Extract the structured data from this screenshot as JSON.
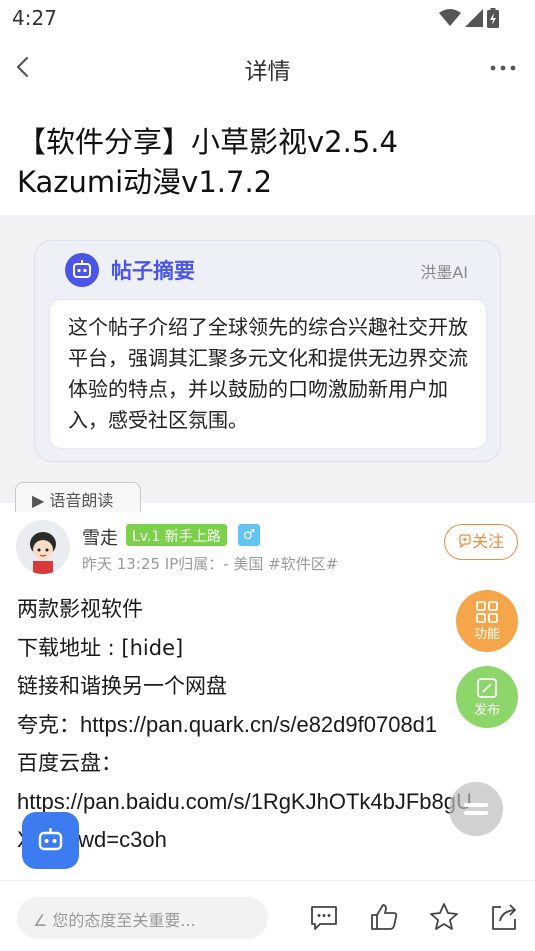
{
  "status_bar": {
    "time": "4:27"
  },
  "nav": {
    "title": "详情"
  },
  "post": {
    "title_line1": "【软件分享】小草影视v2.5.4",
    "title_line2": "Kazumi动漫v1.7.2"
  },
  "summary": {
    "title": "帖子摘要",
    "brand": "洪墨AI",
    "text": "这个帖子介绍了全球领先的综合兴趣社交开放平台，强调其汇聚多元文化和提供无边界交流体验的特点，并以鼓励的口吻激励新用户加入，感受社区氛围。",
    "read_aloud": "▶ 语音朗读"
  },
  "author": {
    "name": "雪走",
    "level": "Lv.1 新手上路",
    "gender_symbol": "♂",
    "meta": "昨天 13:25  IP归属：-  美国 #软件区#",
    "follow_label": "关注"
  },
  "body": {
    "line1": "两款影视软件",
    "line2": "下载地址 : [hide]",
    "line3": "链接和谐换另一个网盘",
    "line4_label": "夸克：",
    "line4_url": "https://pan.quark.cn/s/e82d9f0708d1",
    "line5": "百度云盘：",
    "line6": "https://pan.baidu.com/s/1RgKJhOTk4bJFb8gU",
    "line7": "X   w?pwd=c3oh"
  },
  "fabs": {
    "func_label": "功能",
    "post_label": "发布"
  },
  "bottom_bar": {
    "comment_placeholder": "∠ 您的态度至关重要..."
  },
  "colors": {
    "accent_ai": "#4b56e8",
    "follow": "#f08a40",
    "level_badge": "#7bd14a",
    "gender_badge": "#61c4f2",
    "fab_func": "#f5a64a",
    "fab_post": "#8dd66a",
    "fab_ai": "#3d7bf0"
  }
}
